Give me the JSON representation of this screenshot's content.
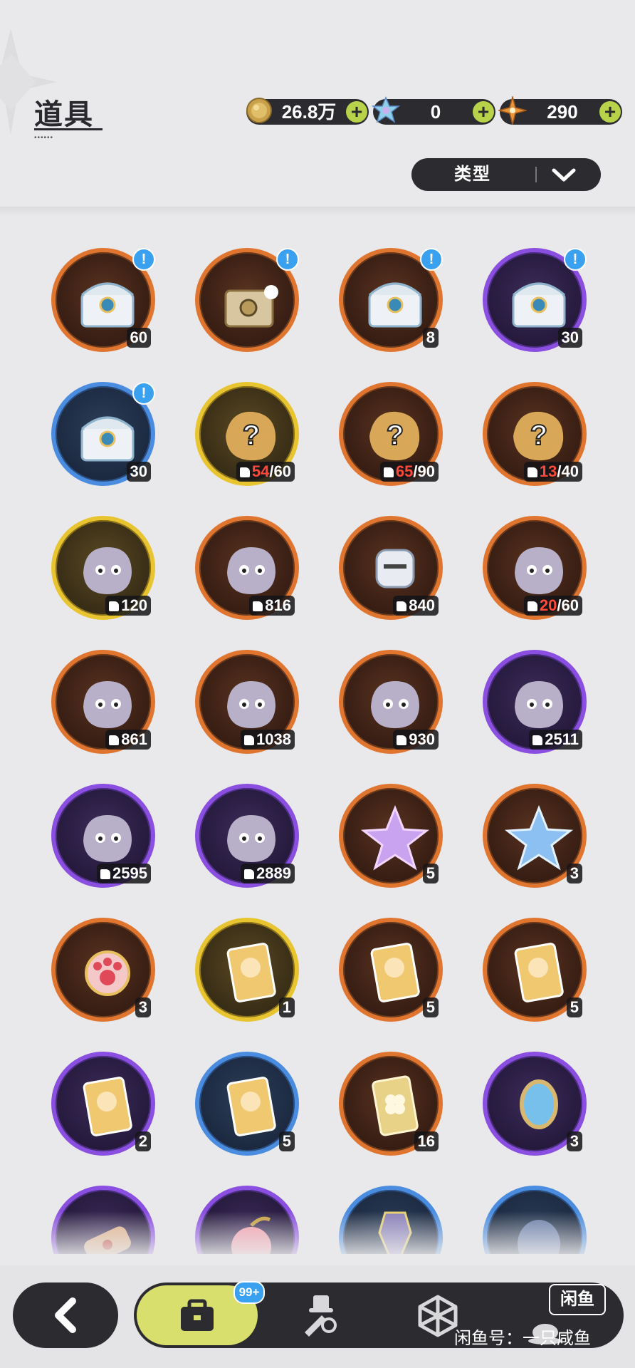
{
  "header": {
    "title": "道具"
  },
  "currencies": [
    {
      "icon": "gold-coin-icon",
      "value": "26.8万"
    },
    {
      "icon": "crystal-icon",
      "value": "0"
    },
    {
      "icon": "star-shard-icon",
      "value": "290"
    }
  ],
  "filter": {
    "label": "类型"
  },
  "items": [
    {
      "rarity": "orange",
      "art": "treasure-chest-icon",
      "count": "60",
      "alert": true
    },
    {
      "rarity": "orange",
      "art": "golden-chest-icon",
      "count": "",
      "alert": true
    },
    {
      "rarity": "orange",
      "art": "treasure-chest-icon",
      "count": "8",
      "alert": true
    },
    {
      "rarity": "purple",
      "art": "treasure-chest-icon",
      "count": "30",
      "alert": true
    },
    {
      "rarity": "blue",
      "art": "treasure-chest-icon",
      "count": "30",
      "alert": true
    },
    {
      "rarity": "gold",
      "art": "mystery-box-icon",
      "frag_have": "54",
      "frag_need": "/60",
      "alert": false
    },
    {
      "rarity": "orange",
      "art": "mystery-box-icon",
      "frag_have": "65",
      "frag_need": "/90",
      "alert": false
    },
    {
      "rarity": "orange",
      "art": "mystery-box-icon",
      "frag_have": "13",
      "frag_need": "/40",
      "alert": false
    },
    {
      "rarity": "gold",
      "art": "creature-fragment-icon",
      "frag_count": "120"
    },
    {
      "rarity": "orange",
      "art": "creature-fragment-icon",
      "frag_count": "816"
    },
    {
      "rarity": "orange",
      "art": "knight-fragment-icon",
      "frag_count": "840"
    },
    {
      "rarity": "orange",
      "art": "creature-fragment-icon",
      "frag_have": "20",
      "frag_need": "/60"
    },
    {
      "rarity": "orange",
      "art": "creature-fragment-icon",
      "frag_count": "861"
    },
    {
      "rarity": "orange",
      "art": "creature-fragment-icon",
      "frag_count": "1038"
    },
    {
      "rarity": "orange",
      "art": "creature-fragment-icon",
      "frag_count": "930"
    },
    {
      "rarity": "purple",
      "art": "creature-fragment-icon",
      "frag_count": "2511"
    },
    {
      "rarity": "purple",
      "art": "creature-fragment-icon",
      "frag_count": "2595"
    },
    {
      "rarity": "purple",
      "art": "creature-fragment-icon",
      "frag_count": "2889"
    },
    {
      "rarity": "orange",
      "art": "pink-star-crystal-icon",
      "count": "5"
    },
    {
      "rarity": "orange",
      "art": "blue-star-crystal-icon",
      "count": "3"
    },
    {
      "rarity": "orange",
      "art": "paw-charm-icon",
      "count": "3"
    },
    {
      "rarity": "gold",
      "art": "character-card-icon",
      "count": "1"
    },
    {
      "rarity": "orange",
      "art": "character-card-icon",
      "count": "5"
    },
    {
      "rarity": "orange",
      "art": "character-card-icon",
      "count": "5"
    },
    {
      "rarity": "purple",
      "art": "character-card-icon",
      "count": "2"
    },
    {
      "rarity": "blue",
      "art": "character-card-icon",
      "count": "5"
    },
    {
      "rarity": "orange",
      "art": "clover-card-icon",
      "count": "16"
    },
    {
      "rarity": "purple",
      "art": "magic-mirror-icon",
      "count": "3"
    },
    {
      "rarity": "purple",
      "art": "scroll-icon",
      "count": ""
    },
    {
      "rarity": "purple",
      "art": "apple-icon",
      "count": ""
    },
    {
      "rarity": "blue",
      "art": "crystal-shard-icon",
      "count": ""
    },
    {
      "rarity": "blue",
      "art": "creature-egg-icon",
      "count": ""
    }
  ],
  "nav": {
    "bag_badge": "99+",
    "watermark_logo": "闲鱼",
    "watermark_text": "闲鱼号：一只咸鱼"
  },
  "colors": {
    "orange": "#e07530",
    "purple": "#8a4fe0",
    "blue": "#4a8de0",
    "gold": "#e8c530",
    "accent": "#d8df6c",
    "dark": "#2c2c30"
  }
}
